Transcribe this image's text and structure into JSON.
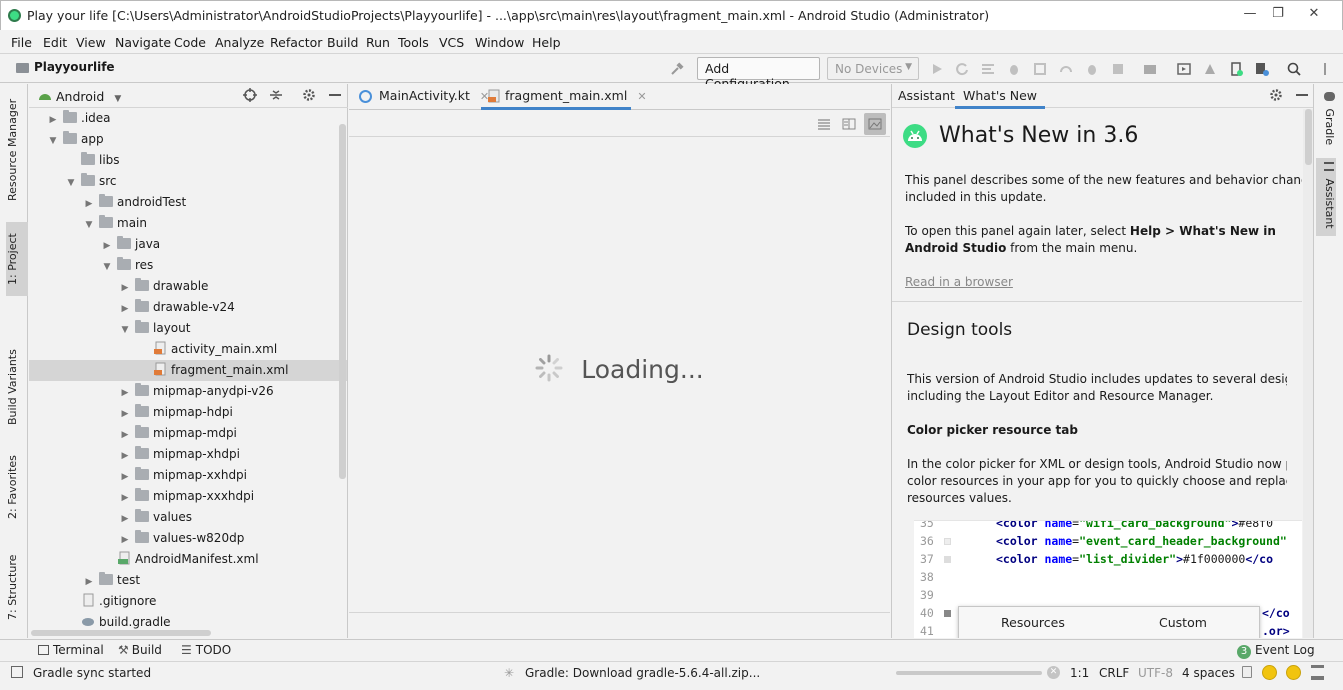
{
  "window": {
    "title": "Play your life [C:\\Users\\Administrator\\AndroidStudioProjects\\Playyourlife] - ...\\app\\src\\main\\res\\layout\\fragment_main.xml - Android Studio (Administrator)",
    "minimize": "—",
    "maximize": "❐",
    "close": "✕"
  },
  "menu": [
    "File",
    "Edit",
    "View",
    "Navigate",
    "Code",
    "Analyze",
    "Refactor",
    "Build",
    "Run",
    "Tools",
    "VCS",
    "Window",
    "Help"
  ],
  "navbar": {
    "project": "Playyourlife",
    "config_button": "Add Configuration...",
    "devices": "No Devices"
  },
  "left_tabs": [
    "Resource Manager",
    "1: Project",
    "Build Variants",
    "2: Favorites",
    "7: Structure"
  ],
  "right_tabs": [
    "Gradle",
    "Assistant"
  ],
  "project_panel": {
    "view_mode": "Android",
    "tree": [
      {
        "label": ".idea",
        "depth": 1,
        "arrow": "right",
        "icon": "folder"
      },
      {
        "label": "app",
        "depth": 1,
        "arrow": "down",
        "icon": "folder"
      },
      {
        "label": "libs",
        "depth": 2,
        "arrow": "",
        "icon": "folder"
      },
      {
        "label": "src",
        "depth": 2,
        "arrow": "down",
        "icon": "folder"
      },
      {
        "label": "androidTest",
        "depth": 3,
        "arrow": "right",
        "icon": "folder"
      },
      {
        "label": "main",
        "depth": 3,
        "arrow": "down",
        "icon": "folder"
      },
      {
        "label": "java",
        "depth": 4,
        "arrow": "right",
        "icon": "folder"
      },
      {
        "label": "res",
        "depth": 4,
        "arrow": "down",
        "icon": "folder"
      },
      {
        "label": "drawable",
        "depth": 5,
        "arrow": "right",
        "icon": "folder"
      },
      {
        "label": "drawable-v24",
        "depth": 5,
        "arrow": "right",
        "icon": "folder"
      },
      {
        "label": "layout",
        "depth": 5,
        "arrow": "down",
        "icon": "folder"
      },
      {
        "label": "activity_main.xml",
        "depth": 6,
        "arrow": "",
        "icon": "xml"
      },
      {
        "label": "fragment_main.xml",
        "depth": 6,
        "arrow": "",
        "icon": "xml",
        "selected": true
      },
      {
        "label": "mipmap-anydpi-v26",
        "depth": 5,
        "arrow": "right",
        "icon": "folder"
      },
      {
        "label": "mipmap-hdpi",
        "depth": 5,
        "arrow": "right",
        "icon": "folder"
      },
      {
        "label": "mipmap-mdpi",
        "depth": 5,
        "arrow": "right",
        "icon": "folder"
      },
      {
        "label": "mipmap-xhdpi",
        "depth": 5,
        "arrow": "right",
        "icon": "folder"
      },
      {
        "label": "mipmap-xxhdpi",
        "depth": 5,
        "arrow": "right",
        "icon": "folder"
      },
      {
        "label": "mipmap-xxxhdpi",
        "depth": 5,
        "arrow": "right",
        "icon": "folder"
      },
      {
        "label": "values",
        "depth": 5,
        "arrow": "right",
        "icon": "folder"
      },
      {
        "label": "values-w820dp",
        "depth": 5,
        "arrow": "right",
        "icon": "folder"
      },
      {
        "label": "AndroidManifest.xml",
        "depth": 4,
        "arrow": "",
        "icon": "manifest"
      },
      {
        "label": "test",
        "depth": 3,
        "arrow": "right",
        "icon": "folder"
      },
      {
        "label": ".gitignore",
        "depth": 2,
        "arrow": "",
        "icon": "file"
      },
      {
        "label": "build.gradle",
        "depth": 2,
        "arrow": "",
        "icon": "gradle"
      }
    ]
  },
  "editor": {
    "tabs": [
      {
        "label": "MainActivity.kt",
        "active": false
      },
      {
        "label": "fragment_main.xml",
        "active": true
      }
    ],
    "loading_text": "Loading..."
  },
  "assistant": {
    "tabs": [
      "Assistant",
      "What's New"
    ],
    "heading": "What's New in 3.6",
    "intro_lines": [
      "This panel describes some of the new features and behavior changes",
      "included in this update."
    ],
    "reopen_prefix": "To open this panel again later, select ",
    "reopen_bold1": "Help > What's New in",
    "reopen_bold2": "Android Studio",
    "reopen_suffix": " from the main menu.",
    "read_link": "Read in a browser",
    "section_title": "Design tools",
    "design_lines": [
      "This version of Android Studio includes updates to several design tools",
      "including the Layout Editor and Resource Manager."
    ],
    "subsection_title": "Color picker resource tab",
    "color_lines": [
      "In the color picker for XML or design tools, Android Studio now populates",
      "color resources in your app for you to quickly choose and replace color",
      "resources values."
    ],
    "code_lines": [
      {
        "num": "35",
        "name": "wifi_card_background",
        "value": "#e8f0"
      },
      {
        "num": "36",
        "name": "event_card_header_background",
        "value": ""
      },
      {
        "num": "37",
        "name": "list_divider",
        "value": "#1f000000"
      },
      {
        "num": "38",
        "name": "",
        "value": ""
      },
      {
        "num": "39",
        "name": "",
        "value": ""
      },
      {
        "num": "40",
        "name": "",
        "value": "</co"
      },
      {
        "num": "41",
        "name": "",
        "value": ".or>"
      }
    ],
    "picker_tabs": [
      "Resources",
      "Custom"
    ]
  },
  "bottom_tools": [
    "Terminal",
    "Build",
    "TODO"
  ],
  "event_log": {
    "count": "3",
    "label": "Event Log"
  },
  "status": {
    "message": "Gradle sync started",
    "task": "Gradle: Download gradle-5.6.4-all.zip...",
    "position": "1:1",
    "line_sep": "CRLF",
    "encoding": "UTF-8",
    "indent": "4 spaces"
  }
}
